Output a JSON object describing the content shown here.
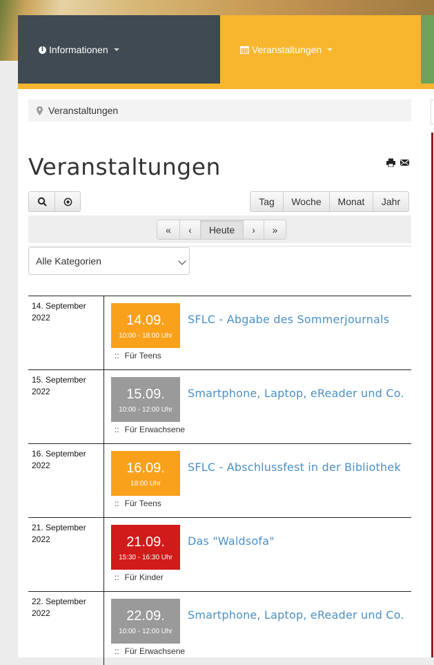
{
  "nav": {
    "items": [
      {
        "label": "Informationen",
        "icon": "info-circle-icon"
      },
      {
        "label": "Veranstaltungen",
        "icon": "calendar-icon"
      }
    ],
    "colors": {
      "dark": "#3f4a52",
      "accent": "#f7b62e",
      "green": "#6fa35a"
    }
  },
  "breadcrumb": {
    "label": "Veranstaltungen"
  },
  "page": {
    "title": "Veranstaltungen"
  },
  "toolbar": {
    "view_buttons": [
      "Tag",
      "Woche",
      "Monat",
      "Jahr"
    ],
    "pager": {
      "first": "«",
      "prev": "‹",
      "today": "Heute",
      "next": "›",
      "last": "»"
    }
  },
  "filter": {
    "selected": "Alle Kategorien"
  },
  "events": [
    {
      "date": "14. September 2022",
      "day": "14.09.",
      "time": "10:00 - 18:00 Uhr",
      "title": "SFLC - Abgabe des Sommerjournals",
      "category": "Für Teens",
      "color": "#f9a11b"
    },
    {
      "date": "15. September 2022",
      "day": "15.09.",
      "time": "10:00 - 12:00 Uhr",
      "title": "Smartphone, Laptop, eReader und Co.",
      "category": "Für Erwachsene",
      "color": "#9a9a9a"
    },
    {
      "date": "16. September 2022",
      "day": "16.09.",
      "time": "18:00 Uhr",
      "title": "SFLC - Abschlussfest in der Bibliothek",
      "category": "Für Teens",
      "color": "#f9a11b"
    },
    {
      "date": "21. September 2022",
      "day": "21.09.",
      "time": "15:30 - 16:30 Uhr",
      "title": "Das \"Waldsofa\"",
      "category": "Für Kinder",
      "color": "#d11a1a"
    },
    {
      "date": "22. September 2022",
      "day": "22.09.",
      "time": "10:00 - 12:00 Uhr",
      "title": "Smartphone, Laptop, eReader und Co.",
      "category": "Für Erwachsene",
      "color": "#9a9a9a"
    }
  ]
}
